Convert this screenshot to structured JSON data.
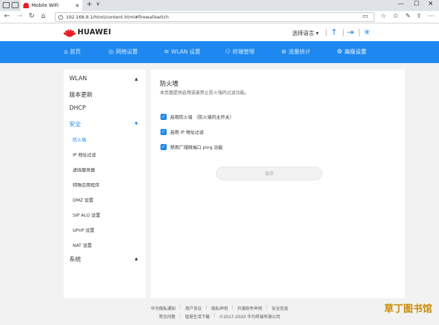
{
  "browser": {
    "tab_title": "Mobile WiFi",
    "url": "192.168.8.1/html/content.html#firewallswitch"
  },
  "header": {
    "brand": "HUAWEI",
    "language": "选择语言 ▾"
  },
  "topnav": {
    "items": [
      {
        "label": "首页",
        "icon": "home-icon"
      },
      {
        "label": "网络设置",
        "icon": "globe-icon"
      },
      {
        "label": "WLAN 设置",
        "icon": "wifi-icon"
      },
      {
        "label": "终端管理",
        "icon": "devices-icon"
      },
      {
        "label": "流量统计",
        "icon": "traffic-icon"
      },
      {
        "label": "高级设置",
        "icon": "gear-icon"
      }
    ]
  },
  "sidebar": {
    "sections": [
      "WLAN",
      "版本更新",
      "DHCP",
      "安全",
      "系统"
    ],
    "security_items": [
      "防火墙",
      "IP 地址过滤",
      "虚拟服务器",
      "特殊应用程序",
      "DMZ 设置",
      "SIP ALG 设置",
      "UPnP 设置",
      "NAT 设置"
    ]
  },
  "content": {
    "title": "防火墙",
    "description": "本页面提供启用或者禁止防火墙的过滤功能。",
    "options": [
      {
        "label": "启用防火墙 （防火墙的主开关）",
        "checked": true
      },
      {
        "label": "启用 IP 地址过滤",
        "checked": true
      },
      {
        "label": "禁用广域网端口 ping 功能",
        "checked": true
      }
    ],
    "save_label": "保存"
  },
  "footer": {
    "row1": [
      "华为隐私通知",
      "用户协议",
      "隐私声明",
      "开源软件声明",
      "安全信息"
    ],
    "row2": [
      "常见问题",
      "智慧生活下载",
      "©2017-2020 华为终端有限公司"
    ]
  },
  "watermark": "草丁图书馆",
  "colors": {
    "accent": "#1e88f0",
    "brand_red": "#e41e26"
  }
}
